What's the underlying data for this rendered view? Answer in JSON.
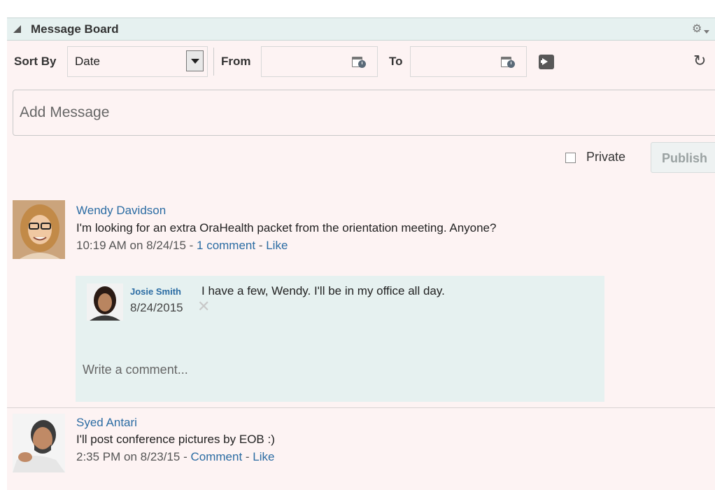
{
  "panel": {
    "title": "Message Board",
    "icons": {
      "collapse": "triangle-icon",
      "settings": "gear-icon"
    }
  },
  "filters": {
    "sort_label": "Sort By",
    "sort_value": "Date",
    "from_label": "From",
    "from_value": "",
    "to_label": "To",
    "to_value": ""
  },
  "compose": {
    "placeholder": "Add Message",
    "private_label": "Private",
    "private_checked": false,
    "publish_label": "Publish"
  },
  "posts": [
    {
      "author": "Wendy Davidson",
      "text": "I'm looking for an extra OraHealth packet from the orientation meeting. Anyone?",
      "time": "10:19 AM on 8/24/15",
      "sep1": " - ",
      "comment_link": "1 comment",
      "sep2": " - ",
      "like_link": "Like",
      "comments": [
        {
          "author": "Josie Smith",
          "text": "I have a few, Wendy. I'll be in my office all day.",
          "date": "8/24/2015"
        }
      ],
      "write_placeholder": "Write a comment..."
    },
    {
      "author": "Syed Antari",
      "text": "I'll post conference pictures by EOB :)",
      "time": "2:35 PM on 8/23/15",
      "sep1": " - ",
      "comment_link": "Comment",
      "sep2": " - ",
      "like_link": "Like"
    }
  ],
  "colors": {
    "panel_bg": "#fdf3f3",
    "header_bg": "#e6f1f0",
    "link": "#2b6ca3",
    "comment_bg": "#e6f1f0"
  }
}
